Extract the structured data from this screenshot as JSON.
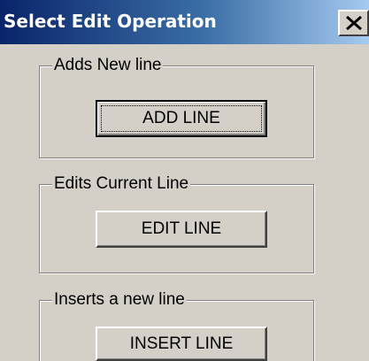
{
  "window": {
    "title": "Select Edit Operation",
    "close_glyph": "close-icon"
  },
  "groups": [
    {
      "label": "Adds New line",
      "button_label": "ADD LINE",
      "is_default": true
    },
    {
      "label": "Edits Current Line",
      "button_label": "EDIT LINE",
      "is_default": false
    },
    {
      "label": "Inserts a new line",
      "button_label": "INSERT LINE",
      "is_default": false
    }
  ],
  "colors": {
    "titlebar_start": "#0a246a",
    "titlebar_end": "#a6caf0",
    "face": "#d4d0c8"
  }
}
